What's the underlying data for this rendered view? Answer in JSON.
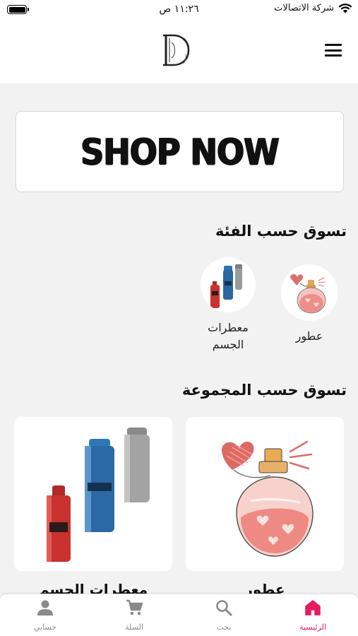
{
  "status_bar": {
    "carrier": "شركة الاتصالات",
    "time": "١١:٢٦ ص"
  },
  "header": {
    "logo_icon": "brand-logo-d",
    "menu_icon": "hamburger-menu-icon"
  },
  "banner": {
    "text": "SHOP NOW"
  },
  "categories": {
    "title": "تسوق حسب الفئة",
    "items": [
      {
        "label": "عطور",
        "icon": "perfume-bottle"
      },
      {
        "label": "معطرات الجسم",
        "icon": "body-spray-cans"
      }
    ]
  },
  "groups": {
    "title": "تسوق حسب المجموعة",
    "items": [
      {
        "label": "عطور",
        "icon": "perfume-bottle"
      },
      {
        "label": "معطرات الجسم",
        "icon": "body-spray-cans"
      }
    ]
  },
  "bottom_nav": {
    "items": [
      {
        "label": "الرئيسية",
        "icon": "home-icon",
        "active": true
      },
      {
        "label": "بحث",
        "icon": "search-icon",
        "active": false
      },
      {
        "label": "السلة",
        "icon": "cart-icon",
        "active": false
      },
      {
        "label": "حسابي",
        "icon": "person-icon",
        "active": false
      }
    ],
    "active_color": "#e8195c",
    "inactive_color": "#8a8a8a"
  }
}
